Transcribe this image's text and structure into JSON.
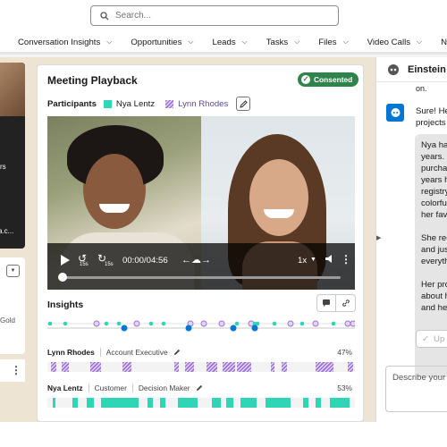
{
  "search": {
    "placeholder": "Search..."
  },
  "nav": {
    "items": [
      {
        "label": "Conversation Insights"
      },
      {
        "label": "Opportunities"
      },
      {
        "label": "Leads"
      },
      {
        "label": "Tasks"
      },
      {
        "label": "Files"
      },
      {
        "label": "Video Calls"
      },
      {
        "label": "N"
      }
    ]
  },
  "left": {
    "text1": "rs",
    "text2": "a.c...",
    "text3": "Gold"
  },
  "playback": {
    "title": "Meeting Playback",
    "consent_badge": "Consented",
    "participants_label": "Participants",
    "participant1": "Nya Lentz",
    "participant2": "Lynn Rhodes",
    "skip_back": "15s",
    "skip_forward": "15s",
    "time": "00:00/04:56",
    "speed": "1x",
    "progress": 0
  },
  "insights": {
    "title": "Insights",
    "speakers": [
      {
        "name": "Lynn Rhodes",
        "role1": "Account Executive",
        "role2": "",
        "pct": "47%"
      },
      {
        "name": "Nya Lentz",
        "role1": "Customer",
        "role2": "Decision Maker",
        "pct": "53%"
      }
    ]
  },
  "einstein": {
    "title": "Einstein",
    "prev_fragment": "on.",
    "msg1": "Sure! He\nprojects",
    "bubble": [
      "Nya has\nyears. L\npurchas\nyears ha\nregistry\ncolorful\nher favo",
      "She rec\nand just\neveryth",
      "Her pro\nabout h\nand her"
    ],
    "button": "Up",
    "input_placeholder": "Describe your"
  },
  "colors": {
    "teal": "#2fd6b5",
    "purple": "#9e72d8",
    "green": "#2e844a",
    "blue": "#0176d3"
  }
}
